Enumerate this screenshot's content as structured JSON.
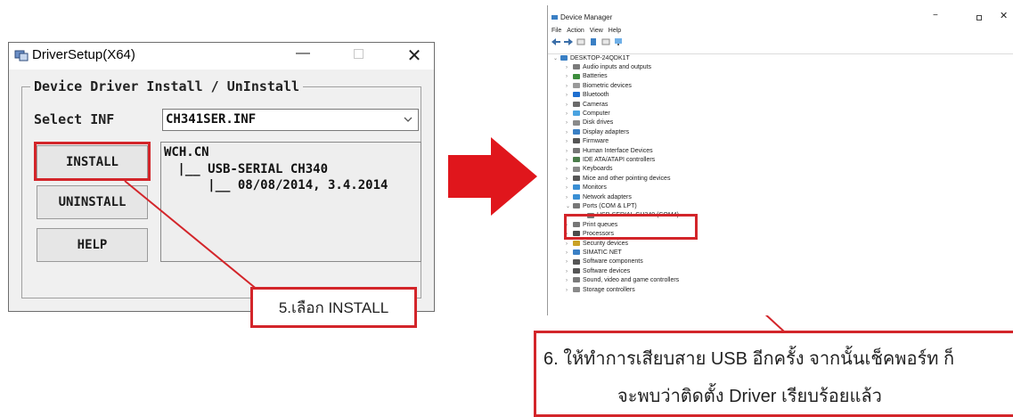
{
  "driver_setup": {
    "title": "DriverSetup(X64)",
    "minimize": "—",
    "close": "✕",
    "group_title": "Device Driver Install / UnInstall",
    "select_label": "Select INF",
    "select_value": "CH341SER.INF",
    "install_label": "INSTALL",
    "uninstall_label": "UNINSTALL",
    "help_label": "HELP",
    "info_lines": [
      "WCH.CN",
      " |__ USB-SERIAL CH340",
      "     |__ 08/08/2014, 3.4.2014"
    ]
  },
  "callout_5": "5.เลือก INSTALL",
  "device_manager": {
    "title": "Device Manager",
    "minimize": "−",
    "close": "✕",
    "menu": [
      "File",
      "Action",
      "View",
      "Help"
    ],
    "root": "DESKTOP-24QDK1T",
    "items": [
      {
        "label": "Audio inputs and outputs",
        "color": "#7a7a7a"
      },
      {
        "label": "Batteries",
        "color": "#3c8d3c"
      },
      {
        "label": "Biometric devices",
        "color": "#9a9a9a"
      },
      {
        "label": "Bluetooth",
        "color": "#1e6fd0"
      },
      {
        "label": "Cameras",
        "color": "#6a6a6a"
      },
      {
        "label": "Computer",
        "color": "#4aa3e0"
      },
      {
        "label": "Disk drives",
        "color": "#8a8a8a"
      },
      {
        "label": "Display adapters",
        "color": "#3a7fc4"
      },
      {
        "label": "Firmware",
        "color": "#555555"
      },
      {
        "label": "Human Interface Devices",
        "color": "#777777"
      },
      {
        "label": "IDE ATA/ATAPI controllers",
        "color": "#4b7d4b"
      },
      {
        "label": "Keyboards",
        "color": "#8a8a8a"
      },
      {
        "label": "Mice and other pointing devices",
        "color": "#555555"
      },
      {
        "label": "Monitors",
        "color": "#3a8fd4"
      },
      {
        "label": "Network adapters",
        "color": "#3a8fd4"
      },
      {
        "label": "Ports (COM & LPT)",
        "color": "#777777"
      },
      {
        "label": "USB-SERIAL CH340 (COM4)",
        "color": "#777777",
        "child": true
      },
      {
        "label": "Print queues",
        "color": "#777777"
      },
      {
        "label": "Processors",
        "color": "#4b4b4b"
      },
      {
        "label": "Security devices",
        "color": "#c9a227"
      },
      {
        "label": "SIMATIC NET",
        "color": "#3a7fc4"
      },
      {
        "label": "Software components",
        "color": "#555555"
      },
      {
        "label": "Software devices",
        "color": "#555555"
      },
      {
        "label": "Sound, video and game controllers",
        "color": "#7a7a7a"
      },
      {
        "label": "Storage controllers",
        "color": "#8a8a8a"
      }
    ]
  },
  "callout_6": {
    "line1": "6. ให้ทำการเสียบสาย USB อีกครั้ง จากนั้นเช็คพอร์ท ก็",
    "line2": "จะพบว่าติดตั้ง Driver เรียบร้อยแล้ว"
  },
  "colors": {
    "highlight": "#d3252a",
    "arrow": "#e0161c"
  }
}
